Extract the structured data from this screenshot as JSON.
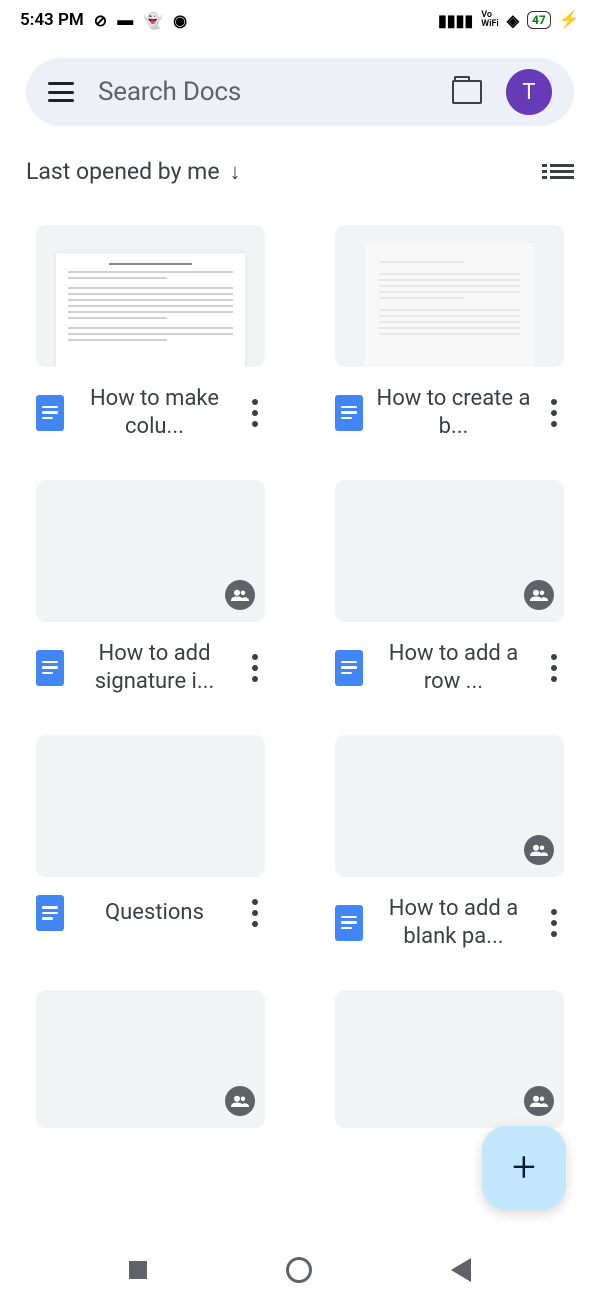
{
  "status": {
    "time": "5:43 PM",
    "battery": "47",
    "vowifi": "Vo\nWiFi"
  },
  "search": {
    "placeholder": "Search Docs",
    "avatar_initial": "T"
  },
  "sort": {
    "label": "Last opened by me",
    "direction": "↓"
  },
  "documents": [
    {
      "title": "How to make colu...",
      "shared": false,
      "has_preview": true
    },
    {
      "title": "How to create a b...",
      "shared": false,
      "has_pale_preview": true
    },
    {
      "title": "How to add signature i...",
      "shared": true
    },
    {
      "title": "How to add a row ...",
      "shared": true
    },
    {
      "title": "Questions",
      "shared": false
    },
    {
      "title": "How to add a blank pa...",
      "shared": true
    },
    {
      "title": "",
      "shared": true
    },
    {
      "title": "",
      "shared": true
    }
  ],
  "fab": {
    "label": "+"
  }
}
